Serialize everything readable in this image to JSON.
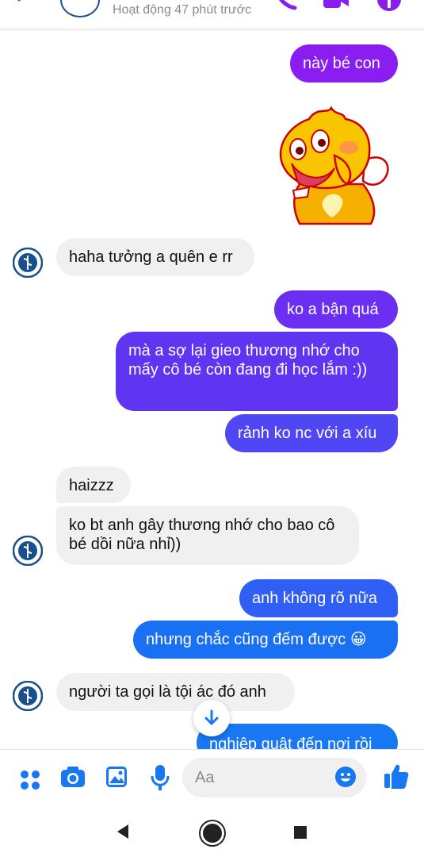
{
  "header": {
    "status": "Hoạt động 47 phút trước"
  },
  "messages": {
    "m1": "này bé con",
    "m2": "haha tưởng a quên e rr",
    "m3": "ko a bận quá",
    "m4": "mà a sợ lại gieo thương nhớ cho mấy cô bé còn đang đi học lắm :))",
    "m5": "rảnh ko nc với a xíu",
    "m6": "haizzz",
    "m7": "ko bt anh gây thương nhớ cho bao cô bé dồi nữa nhỉ))",
    "m8": "anh không rõ nữa",
    "m9": "nhưng chắc cũng đếm được 😀",
    "m10": "người ta gọi là tội ác đó anh",
    "m11": "nghiệp quật đến nơi rồi"
  },
  "composer": {
    "placeholder": "Aa"
  },
  "colors": {
    "accent": "#1877f2",
    "bubble_purple": "#8a1ef0",
    "bubble_violet": "#6a2ff2",
    "bubble_indigo": "#4a4ff3",
    "bubble_blue": "#1877f2",
    "received_bubble": "#f1f0f0"
  },
  "icons": [
    "back-icon",
    "phone-icon",
    "video-icon",
    "info-icon",
    "menu-dots-icon",
    "camera-icon",
    "gallery-icon",
    "microphone-icon",
    "emoji-icon",
    "thumbs-up-icon",
    "arrow-down-icon"
  ]
}
